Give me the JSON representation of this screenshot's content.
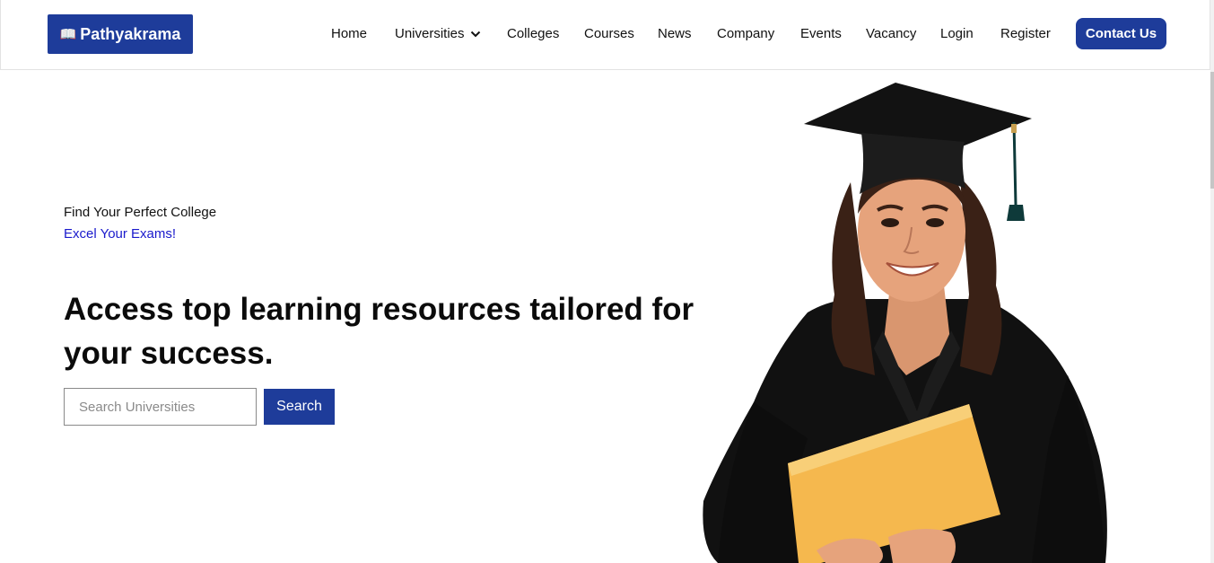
{
  "brand": {
    "name": "Pathyakrama",
    "icon": "open-book-icon"
  },
  "nav": {
    "items": [
      {
        "label": "Home"
      },
      {
        "label": "Universities",
        "has_dropdown": true
      },
      {
        "label": "Colleges"
      },
      {
        "label": "Courses"
      },
      {
        "label": "News"
      },
      {
        "label": "Company"
      },
      {
        "label": "Events"
      },
      {
        "label": "Vacancy"
      },
      {
        "label": "Login"
      },
      {
        "label": "Register"
      }
    ],
    "contact_label": "Contact Us"
  },
  "hero": {
    "tagline": "Find Your Perfect College",
    "subtagline": "Excel Your Exams!",
    "headline": "Access top learning resources tailored for your success.",
    "search_placeholder": "Search Universities",
    "search_button": "Search",
    "image": "graduate-student-photo"
  },
  "colors": {
    "brand_blue": "#1e3c9a",
    "link_blue": "#1a1acc",
    "folder_yellow": "#f5b84e"
  }
}
